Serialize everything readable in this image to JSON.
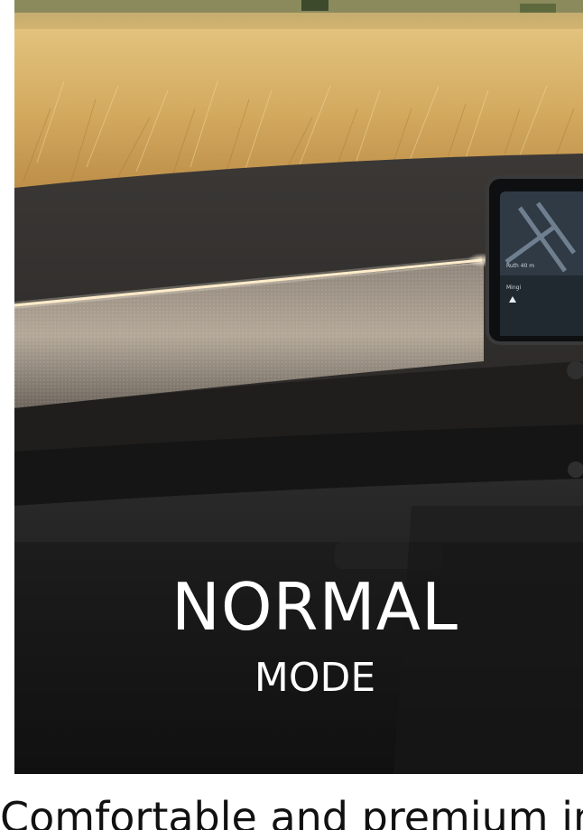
{
  "hero": {
    "title": "NORMAL",
    "subtitle": "MODE",
    "screen": {
      "label_top": "Ruth 40 m",
      "label_street": "Mingi"
    }
  },
  "below": {
    "caption": "Comfortable and premium interior"
  },
  "colors": {
    "wheat": "#d9b56d",
    "dashboard": "#2a2827",
    "ambient_light": "#ffe9c2",
    "text_light": "#ffffff"
  }
}
